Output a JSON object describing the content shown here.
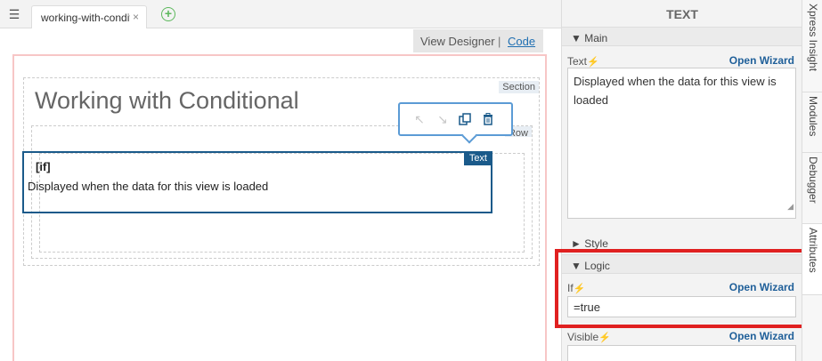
{
  "tabbar": {
    "tab_label": "working-with-conditional",
    "close_glyph": "×",
    "add_glyph": "+"
  },
  "view_switch": {
    "designer": "View Designer",
    "separator": "|",
    "code": "Code"
  },
  "canvas": {
    "section_badge": "Section",
    "title": "Working with Conditional",
    "row_badge": "Row",
    "text_badge": "Text",
    "if_label": "[if]",
    "text_content": "Displayed when the data for this view is loaded"
  },
  "panel": {
    "title": "TEXT",
    "main_group": "▼ Main",
    "text_label": "Text",
    "open_wizard": "Open Wizard",
    "text_value": "Displayed when the data for this view is loaded",
    "style_group": "► Style",
    "logic_group": "▼ Logic",
    "if_label": "If",
    "if_value": "=true",
    "visible_label": "Visible",
    "bolt": "⚡"
  },
  "vtabs": [
    "Xpress Insight",
    "Modules",
    "Debugger",
    "Attributes"
  ],
  "colors": {
    "accent": "#1a5a8a",
    "highlight": "#e02020",
    "link": "#1f6fb2"
  }
}
